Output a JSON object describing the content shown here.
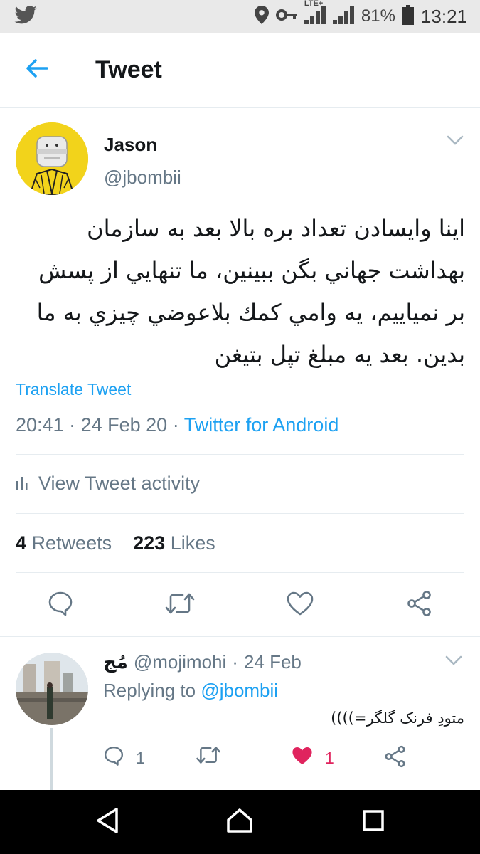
{
  "status_bar": {
    "battery": "81%",
    "time": "13:21",
    "network": "LTE+",
    "icons": [
      "twitter-icon",
      "location-icon",
      "key-icon",
      "signal-icon",
      "battery-icon"
    ]
  },
  "header": {
    "title": "Tweet",
    "back_icon": "arrow-left-icon"
  },
  "tweet": {
    "author_name": "Jason",
    "author_handle": "@jbombii",
    "text": "اینا وایسادن تعداد بره بالا بعد به سازمان بهداشت جهاني بگن ببینین، ما تنهایي از پسش بر نمیاییم، یه وامي كمك بلاعوضي چیزي به ما بدین. بعد یه مبلغ تپل بتیغن",
    "translate_label": "Translate Tweet",
    "time": "20:41",
    "date": "24 Feb 20",
    "separator": "·",
    "source": "Twitter for Android",
    "activity_label": "View Tweet activity",
    "retweets_count": "4",
    "retweets_label": "Retweets",
    "likes_count": "223",
    "likes_label": "Likes"
  },
  "reply": {
    "name": "مُج",
    "handle": "@mojimohi",
    "separator": "·",
    "date": "24 Feb",
    "replying_prefix": "Replying to",
    "replying_to": "@jbombii",
    "text": "متودِ فرنک گلگر=))))",
    "reply_count": "1",
    "like_count": "1"
  },
  "colors": {
    "accent": "#1da1f2",
    "muted": "#657786",
    "like": "#e0245e",
    "avatar_yellow": "#f2d31b"
  }
}
